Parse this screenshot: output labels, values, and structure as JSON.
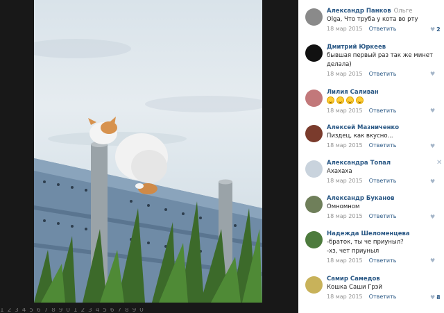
{
  "viewer": {
    "photo_alt": "cat on fence",
    "bottom_text": "1 2 3 4 5 6 7 8 9 0 1 2 3 4 5 6 7 8 9 0"
  },
  "comments": [
    {
      "author": "Александр Панков",
      "reply_to": "Ольге",
      "text": "Olga, Что труба у кота во рту",
      "date": "18 мар 2015",
      "reply": "Ответить",
      "likes": "2",
      "avatar_color": "#8a8a8a"
    },
    {
      "author": "Дмитрий Юркеев",
      "reply_to": "",
      "text": "бывшая первый раз так же минет делала)",
      "date": "18 мар 2015",
      "reply": "Ответить",
      "likes": "",
      "avatar_color": "#111111"
    },
    {
      "author": "Лилия Саливан",
      "reply_to": "",
      "text": "",
      "emoji_count": 4,
      "date": "18 мар 2015",
      "reply": "Ответить",
      "likes": "",
      "avatar_color": "#c2787a"
    },
    {
      "author": "Алексей Мазниченко",
      "reply_to": "",
      "text": "Пиздец, как вкусно...",
      "date": "18 мар 2015",
      "reply": "Ответить",
      "likes": "",
      "avatar_color": "#7a3b2c"
    },
    {
      "author": "Александра Топал",
      "reply_to": "",
      "text": "Ахахаха",
      "date": "18 мар 2015",
      "reply": "Ответить",
      "likes": "",
      "close": "✕",
      "avatar_color": "#c9d3dd"
    },
    {
      "author": "Александр Буканов",
      "reply_to": "",
      "text": "Омномном",
      "date": "18 мар 2015",
      "reply": "Ответить",
      "likes": "",
      "avatar_color": "#6f7f5a"
    },
    {
      "author": "Надежда Шеломенцева",
      "reply_to": "",
      "text": "-браток, ты че приуныл?",
      "text2": "-хз, чет приуныл",
      "date": "18 мар 2015",
      "reply": "Ответить",
      "likes": "",
      "avatar_color": "#4d7b3d"
    },
    {
      "author": "Самир Самедов",
      "reply_to": "",
      "text": "Кошка Саши Грэй",
      "date": "18 мар 2015",
      "reply": "Ответить",
      "likes": "8",
      "avatar_color": "#c8b25a"
    }
  ]
}
